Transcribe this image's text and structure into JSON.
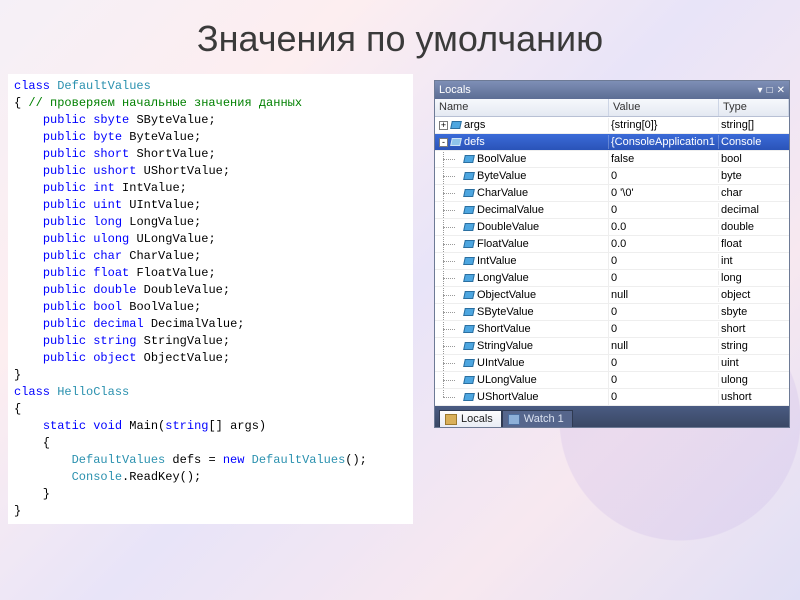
{
  "title": "Значения по умолчанию",
  "code": {
    "class1": "DefaultValues",
    "comment": "// проверяем начальные значения данных",
    "fields": [
      {
        "kw": "public",
        "type": "sbyte",
        "name": "SByteValue"
      },
      {
        "kw": "public",
        "type": "byte",
        "name": "ByteValue"
      },
      {
        "kw": "public",
        "type": "short",
        "name": "ShortValue"
      },
      {
        "kw": "public",
        "type": "ushort",
        "name": "UShortValue"
      },
      {
        "kw": "public",
        "type": "int",
        "name": "IntValue"
      },
      {
        "kw": "public",
        "type": "uint",
        "name": "UIntValue"
      },
      {
        "kw": "public",
        "type": "long",
        "name": "LongValue"
      },
      {
        "kw": "public",
        "type": "ulong",
        "name": "ULongValue"
      },
      {
        "kw": "public",
        "type": "char",
        "name": "CharValue"
      },
      {
        "kw": "public",
        "type": "float",
        "name": "FloatValue"
      },
      {
        "kw": "public",
        "type": "double",
        "name": "DoubleValue"
      },
      {
        "kw": "public",
        "type": "bool",
        "name": "BoolValue"
      },
      {
        "kw": "public",
        "type": "decimal",
        "name": "DecimalValue"
      },
      {
        "kw": "public",
        "type": "string",
        "name": "StringValue"
      },
      {
        "kw": "public",
        "type": "object",
        "name": "ObjectValue"
      }
    ],
    "class2": "HelloClass",
    "mainSig": {
      "kw1": "static",
      "kw2": "void",
      "name": "Main",
      "argtype": "string",
      "argname": "args"
    },
    "body1_type": "DefaultValues",
    "body1_var": "defs",
    "body1_new": "new",
    "body1_ctor": "DefaultValues",
    "body2_type": "Console",
    "body2_call": "ReadKey"
  },
  "locals": {
    "title": "Locals",
    "columns": {
      "name": "Name",
      "value": "Value",
      "type": "Type"
    },
    "rows": [
      {
        "glyph": "+",
        "indent": 0,
        "icon": "field",
        "name": "args",
        "value": "{string[0]}",
        "type": "string[]",
        "sel": false
      },
      {
        "glyph": "-",
        "indent": 0,
        "icon": "field",
        "name": "defs",
        "value": "{ConsoleApplication1",
        "type": "Console",
        "sel": true
      },
      {
        "glyph": "",
        "indent": 1,
        "icon": "field",
        "name": "BoolValue",
        "value": "false",
        "type": "bool",
        "sel": false
      },
      {
        "glyph": "",
        "indent": 1,
        "icon": "field",
        "name": "ByteValue",
        "value": "0",
        "type": "byte",
        "sel": false
      },
      {
        "glyph": "",
        "indent": 1,
        "icon": "field",
        "name": "CharValue",
        "value": "0 '\\0'",
        "type": "char",
        "sel": false
      },
      {
        "glyph": "",
        "indent": 1,
        "icon": "field",
        "name": "DecimalValue",
        "value": "0",
        "type": "decimal",
        "sel": false
      },
      {
        "glyph": "",
        "indent": 1,
        "icon": "field",
        "name": "DoubleValue",
        "value": "0.0",
        "type": "double",
        "sel": false
      },
      {
        "glyph": "",
        "indent": 1,
        "icon": "field",
        "name": "FloatValue",
        "value": "0.0",
        "type": "float",
        "sel": false
      },
      {
        "glyph": "",
        "indent": 1,
        "icon": "field",
        "name": "IntValue",
        "value": "0",
        "type": "int",
        "sel": false
      },
      {
        "glyph": "",
        "indent": 1,
        "icon": "field",
        "name": "LongValue",
        "value": "0",
        "type": "long",
        "sel": false
      },
      {
        "glyph": "",
        "indent": 1,
        "icon": "field",
        "name": "ObjectValue",
        "value": "null",
        "type": "object",
        "sel": false
      },
      {
        "glyph": "",
        "indent": 1,
        "icon": "field",
        "name": "SByteValue",
        "value": "0",
        "type": "sbyte",
        "sel": false
      },
      {
        "glyph": "",
        "indent": 1,
        "icon": "field",
        "name": "ShortValue",
        "value": "0",
        "type": "short",
        "sel": false
      },
      {
        "glyph": "",
        "indent": 1,
        "icon": "field",
        "name": "StringValue",
        "value": "null",
        "type": "string",
        "sel": false
      },
      {
        "glyph": "",
        "indent": 1,
        "icon": "field",
        "name": "UIntValue",
        "value": "0",
        "type": "uint",
        "sel": false
      },
      {
        "glyph": "",
        "indent": 1,
        "icon": "field",
        "name": "ULongValue",
        "value": "0",
        "type": "ulong",
        "sel": false
      },
      {
        "glyph": "",
        "indent": 1,
        "icon": "field",
        "name": "UShortValue",
        "value": "0",
        "type": "ushort",
        "sel": false,
        "last": true
      }
    ],
    "tabs": [
      {
        "label": "Locals",
        "icon": "locals",
        "active": true
      },
      {
        "label": "Watch 1",
        "icon": "watch",
        "active": false
      }
    ],
    "winbtns": {
      "dropdown": "▾",
      "pin": "□",
      "close": "✕"
    }
  }
}
